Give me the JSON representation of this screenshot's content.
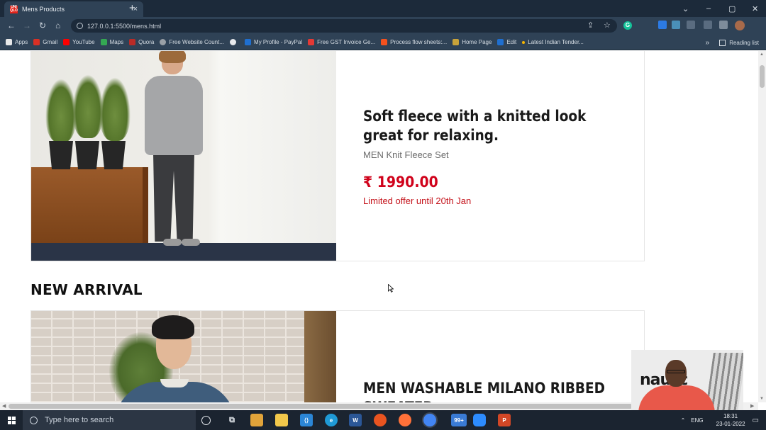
{
  "browser": {
    "tab_title": "Mens Products",
    "favicon_text": "UNI QLO",
    "new_tab": "+",
    "close_tab": "×",
    "url": "127.0.0.1:5500/mens.html",
    "window_controls": [
      "⌄",
      "–",
      "▢",
      "✕"
    ],
    "bookmarks": [
      {
        "label": "Apps",
        "color": "#e8e8e8"
      },
      {
        "label": "Gmail",
        "color": "#d93025"
      },
      {
        "label": "YouTube",
        "color": "#ff0000"
      },
      {
        "label": "Maps",
        "color": "#34a853"
      },
      {
        "label": "Quora",
        "color": "#b92b27"
      },
      {
        "label": "Free Website Count...",
        "color": "#9aa0a6"
      },
      {
        "label": "",
        "color": "#e8eaed"
      },
      {
        "label": "My Profile - PayPal",
        "color": "#1f6fd0"
      },
      {
        "label": "Free GST Invoice Ge...",
        "color": "#e53935"
      },
      {
        "label": "Process flow sheets:...",
        "color": "#f4511e"
      },
      {
        "label": "Home Page",
        "color": "#c9a33a"
      },
      {
        "label": "Edit",
        "color": "#1f6fd0"
      },
      {
        "label": "Latest Indian Tender...",
        "color": "#f6b400"
      }
    ],
    "more_bookmarks": "»",
    "reading_list": "Reading list"
  },
  "products": [
    {
      "title": "Soft fleece with a knitted look great for relaxing.",
      "subtitle": "MEN Knit Fleece Set",
      "price": "₹ 1990.00",
      "offer": "Limited offer until 20th Jan"
    },
    {
      "title": "MEN WASHABLE MILANO RIBBED SWEATER"
    }
  ],
  "sections": {
    "new_arrival": "NEW ARRIVAL"
  },
  "webcam": {
    "sign_text": "nausc"
  },
  "taskbar": {
    "search_placeholder": "Type here to search",
    "badge": "99+",
    "lang": "ENG",
    "time": "18:31",
    "date": "23-01-2022"
  },
  "colors": {
    "price_red": "#d0021b",
    "chrome_dark": "#1c2a3a",
    "chrome_toolbar": "#2f4256"
  }
}
